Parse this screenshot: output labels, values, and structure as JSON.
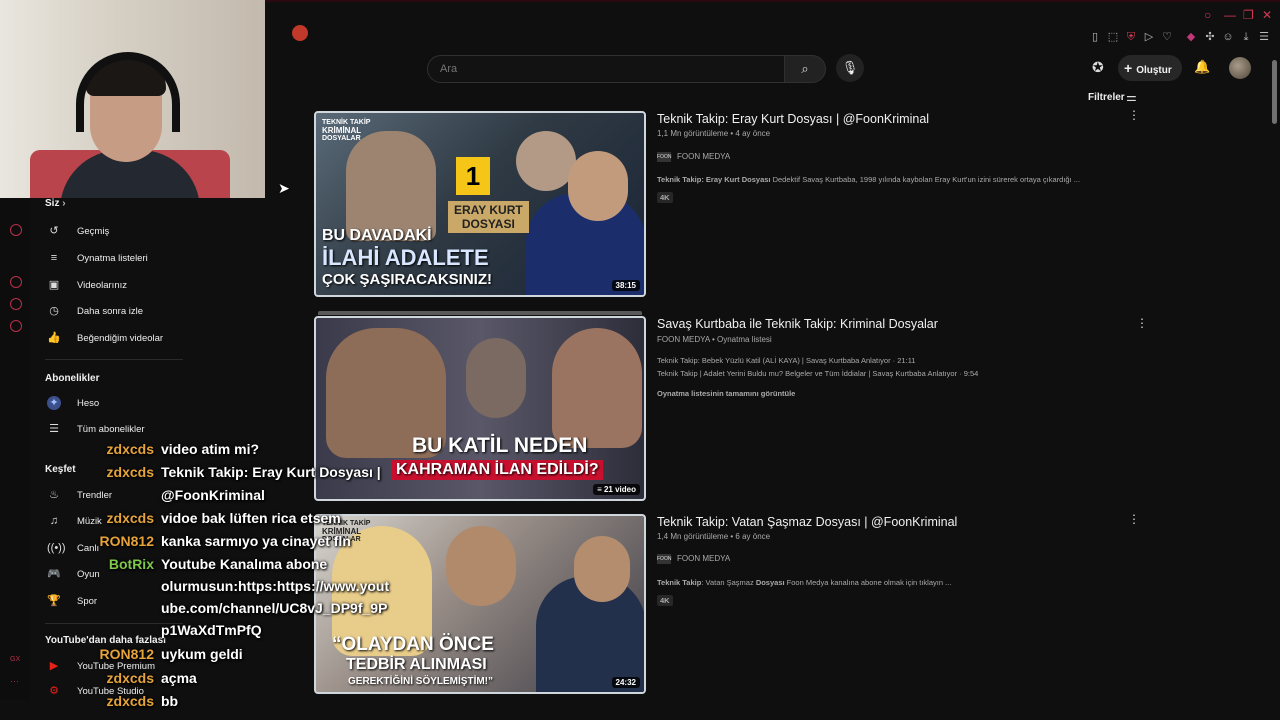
{
  "header": {
    "search_placeholder": "Ara",
    "create_label": "Oluştur",
    "filters_label": "Filtreler"
  },
  "sidebar": {
    "you_title": "Siz",
    "you_items": [
      {
        "label": "Geçmiş",
        "icon": "history-icon"
      },
      {
        "label": "Oynatma listeleri",
        "icon": "playlists-icon"
      },
      {
        "label": "Videolarınız",
        "icon": "your-videos-icon"
      },
      {
        "label": "Daha sonra izle",
        "icon": "watch-later-icon"
      },
      {
        "label": "Beğendiğim videolar",
        "icon": "liked-icon"
      }
    ],
    "subs_title": "Abonelikler",
    "subs_items": [
      {
        "label": "Heso",
        "icon": "channel-avatar-icon"
      },
      {
        "label": "Tüm abonelikler",
        "icon": "list-icon"
      }
    ],
    "explore_title": "Keşfet",
    "explore_items": [
      {
        "label": "Trendler",
        "icon": "trending-icon"
      },
      {
        "label": "Müzik",
        "icon": "music-icon"
      },
      {
        "label": "Canlı",
        "icon": "live-icon"
      },
      {
        "label": "Oyun",
        "icon": "gaming-icon"
      },
      {
        "label": "Spor",
        "icon": "sports-icon"
      }
    ],
    "more_title": "YouTube'dan daha fazlası",
    "more_items": [
      {
        "label": "YouTube Premium",
        "icon": "youtube-premium-icon"
      },
      {
        "label": "YouTube Studio",
        "icon": "youtube-studio-icon"
      }
    ]
  },
  "results": [
    {
      "title": "Teknik Takip: Eray Kurt Dosyası | @FoonKriminal",
      "meta": "1,1 Mn görüntüleme • 4 ay önce",
      "channel": "FOON MEDYA",
      "desc_bold": "Teknik Takip: Eray Kurt Dosyası",
      "desc_rest": " Dedektif Savaş Kurtbaba, 1998 yılında kaybolan Eray Kurt'un izini sürerek ortaya çıkardığı ...",
      "badge": "4K",
      "duration": "38:15",
      "thumb_tag_line1": "TEKNİK TAKİP",
      "thumb_tag_line2": "KRİMİNAL",
      "thumb_tag_line3": "DOSYALAR",
      "thumb_line1": "BU DAVADAKİ",
      "thumb_line2": "İLAHİ ADALETE",
      "thumb_line3": "ÇOK ŞAŞIRACAKSINIZ!",
      "thumb_number": "1",
      "thumb_folder_line1": "ERAY KURT",
      "thumb_folder_line2": "DOSYASI"
    },
    {
      "title": "Savaş Kurtbaba ile Teknik Takip: Kriminal Dosyalar",
      "meta_channel": "FOON MEDYA",
      "meta_type": " • Oynatma listesi",
      "item1": "Teknik Takip: Bebek Yüzlü Katil (ALİ KAYA) | Savaş Kurtbaba Anlatıyor · 21:11",
      "item2": "Teknik Takip | Adalet Yerini Buldu mu? Belgeler ve Tüm İddialar | Savaş Kurtbaba Anlatıyor · 9:54",
      "view_all": "Oynatma listesinin tamamını görüntüle",
      "video_count": "21 video",
      "thumb_line1": "BU KATİL NEDEN",
      "thumb_line2": "KAHRAMAN İLAN EDİLDİ?"
    },
    {
      "title": "Teknik Takip: Vatan Şaşmaz Dosyası | @FoonKriminal",
      "meta": "1,4 Mn görüntüleme • 6 ay önce",
      "channel": "FOON MEDYA",
      "desc_bold1": "Teknik Takip",
      "desc_mid": ": Vatan Şaşmaz ",
      "desc_bold2": "Dosyası",
      "desc_rest": " Foon Medya kanalına abone olmak için tıklayın ...",
      "badge": "4K",
      "duration": "24:32",
      "thumb_tag_line1": "TEKNİK TAKİP",
      "thumb_tag_line2": "KRİMİNAL",
      "thumb_tag_line3": "DOSYALAR",
      "thumb_line1": "“OLAYDAN ÖNCE",
      "thumb_line2": "TEDBİR ALINMASI",
      "thumb_line3": "GEREKTİĞİNİ SÖYLEMİŞTİM!”"
    }
  ],
  "chat": [
    {
      "user": "zdxcds",
      "color": "#e6a33a",
      "msg": "video atim mi?"
    },
    {
      "user": "zdxcds",
      "color": "#e6a33a",
      "msg": "Teknik Takip: Eray Kurt Dosyası |"
    },
    {
      "user": "",
      "color": "#e6a33a",
      "msg": "@FoonKriminal"
    },
    {
      "user": "zdxcds",
      "color": "#e6a33a",
      "msg": "vidoe bak lüften rica etsem"
    },
    {
      "user": "RON812",
      "color": "#e6a33a",
      "msg": "kanka sarmıyo ya cinayet fln"
    },
    {
      "user": "BotRix",
      "color": "#7ec84a",
      "msg": "Youtube Kanalıma abone"
    },
    {
      "user": "",
      "color": "#7ec84a",
      "msg": "olurmusun:https:https://www.yout"
    },
    {
      "user": "",
      "color": "#7ec84a",
      "msg": "ube.com/channel/UC8vJ_DP9f_9P"
    },
    {
      "user": "",
      "color": "#7ec84a",
      "msg": "p1WaXdTmPfQ"
    },
    {
      "user": "RON812",
      "color": "#e6a33a",
      "msg": "uykum geldi"
    },
    {
      "user": "zdxcds",
      "color": "#e6a33a",
      "msg": "açma"
    },
    {
      "user": "zdxcds",
      "color": "#e6a33a",
      "msg": "bb"
    }
  ]
}
